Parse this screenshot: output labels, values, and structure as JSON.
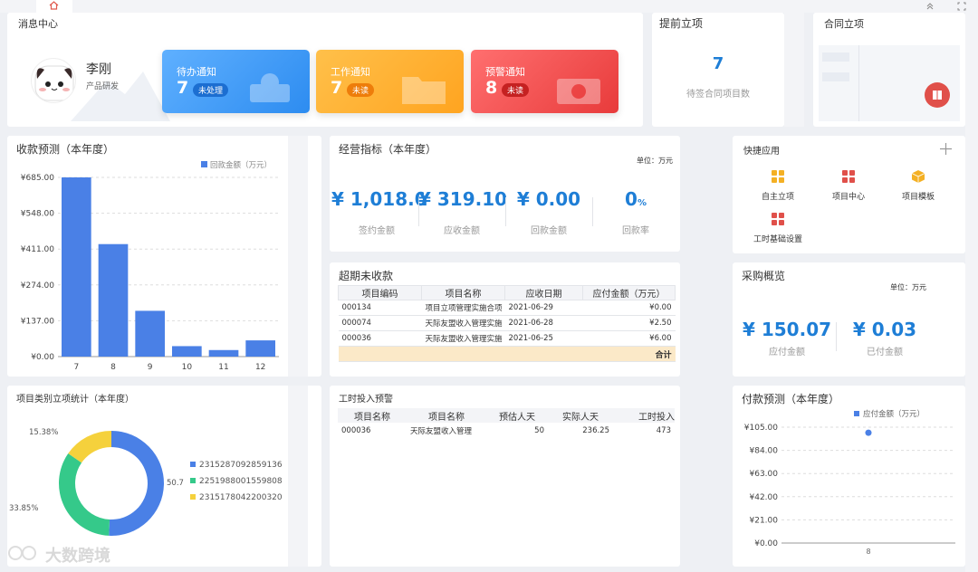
{
  "colors": {
    "blue": "#2d8cf0",
    "orange": "#ffa420",
    "red": "#ef4444",
    "bar": "#4a80e6",
    "accent": "#1e7ed6"
  },
  "top": {
    "home_icon": "home-icon",
    "collapse_icon": "chevron-up-icon",
    "fullscreen_icon": "fullscreen-icon"
  },
  "messages": {
    "title": "消息中心",
    "user_name": "李刚",
    "user_dept": "产品研发",
    "cards": [
      {
        "title": "待办通知",
        "count": "7",
        "badge": "未处理"
      },
      {
        "title": "工作通知",
        "count": "7",
        "badge": "未读"
      },
      {
        "title": "预警通知",
        "count": "8",
        "badge": "未读"
      }
    ]
  },
  "early": {
    "title": "提前立项",
    "count": "7",
    "label": "待签合同项目数"
  },
  "contract": {
    "title": "合同立项"
  },
  "collection": {
    "title": "收款预测（本年度）",
    "chart_data": {
      "type": "bar",
      "legend": "回款金额（万元）",
      "categories": [
        "7",
        "8",
        "9",
        "10",
        "11",
        "12"
      ],
      "values": [
        685,
        430,
        175,
        40,
        25,
        62
      ],
      "ticks": [
        "¥685.00",
        "¥548.00",
        "¥411.00",
        "¥274.00",
        "¥137.00",
        "¥0.00"
      ],
      "ylim": [
        0,
        685
      ],
      "grid": true,
      "legend_position": "top-right"
    }
  },
  "kpi": {
    "title": "经营指标（本年度）",
    "unit": "单位：万元",
    "items": [
      {
        "value": "¥ 1,018.05",
        "label": "签约金额"
      },
      {
        "value": "¥ 319.10",
        "label": "应收金额"
      },
      {
        "value": "¥ 0.00",
        "label": "回款金额"
      },
      {
        "value": "0",
        "suffix": "%",
        "label": "回款率"
      }
    ]
  },
  "overdue": {
    "title": "超期未收款",
    "headers": [
      "项目编码",
      "项目名称",
      "应收日期",
      "应付金额（万元）"
    ],
    "rows": [
      [
        "000134",
        "项目立项管理实施合项",
        "2021-06-29",
        "¥0.00"
      ],
      [
        "000074",
        "天际友盟收入管理实施",
        "2021-06-28",
        "¥2.50"
      ],
      [
        "000036",
        "天际友盟收入管理实施",
        "2021-06-25",
        "¥6.00"
      ]
    ],
    "total_label": "合计"
  },
  "quick": {
    "title": "快捷应用",
    "add_icon": "plus-icon",
    "items": [
      {
        "label": "自主立项",
        "icon": "grid-icon"
      },
      {
        "label": "项目中心",
        "icon": "grid-icon"
      },
      {
        "label": "项目模板",
        "icon": "box-icon"
      },
      {
        "label": "工时基础设置",
        "icon": "grid-icon"
      }
    ]
  },
  "purchase": {
    "title": "采购概览",
    "unit": "单位：万元",
    "items": [
      {
        "value": "¥ 150.07",
        "label": "应付金额"
      },
      {
        "value": "¥ 0.03",
        "label": "已付金额"
      }
    ]
  },
  "category": {
    "title": "项目类别立项统计（本年度）",
    "chart_data": {
      "type": "pie",
      "slices": [
        {
          "name": "2315287092859136",
          "value": 50.77,
          "label": "50.7",
          "color": "#4a80e6"
        },
        {
          "name": "2251988001559808",
          "value": 33.85,
          "label": "33.85%",
          "color": "#35c98a"
        },
        {
          "name": "2315178042200320",
          "value": 15.38,
          "label": "15.38%",
          "color": "#f5d13c"
        }
      ]
    }
  },
  "hours": {
    "title": "工时投入预警",
    "headers": [
      "项目名称",
      "项目名称",
      "预估人天",
      "实际人天",
      "工时投入"
    ],
    "rows": [
      [
        "000036",
        "天际友盟收入管理",
        "50",
        "236.25",
        "473"
      ]
    ]
  },
  "payment": {
    "title": "付款预测（本年度）",
    "chart_data": {
      "type": "scatter",
      "legend": "应付金额（万元）",
      "x": [
        "8"
      ],
      "values": [
        100
      ],
      "ticks": [
        "¥105.00",
        "¥84.00",
        "¥63.00",
        "¥42.00",
        "¥21.00",
        "¥0.00"
      ],
      "ylim": [
        0,
        105
      ],
      "grid": true,
      "legend_position": "top-right"
    }
  },
  "watermark": "大数跨境"
}
